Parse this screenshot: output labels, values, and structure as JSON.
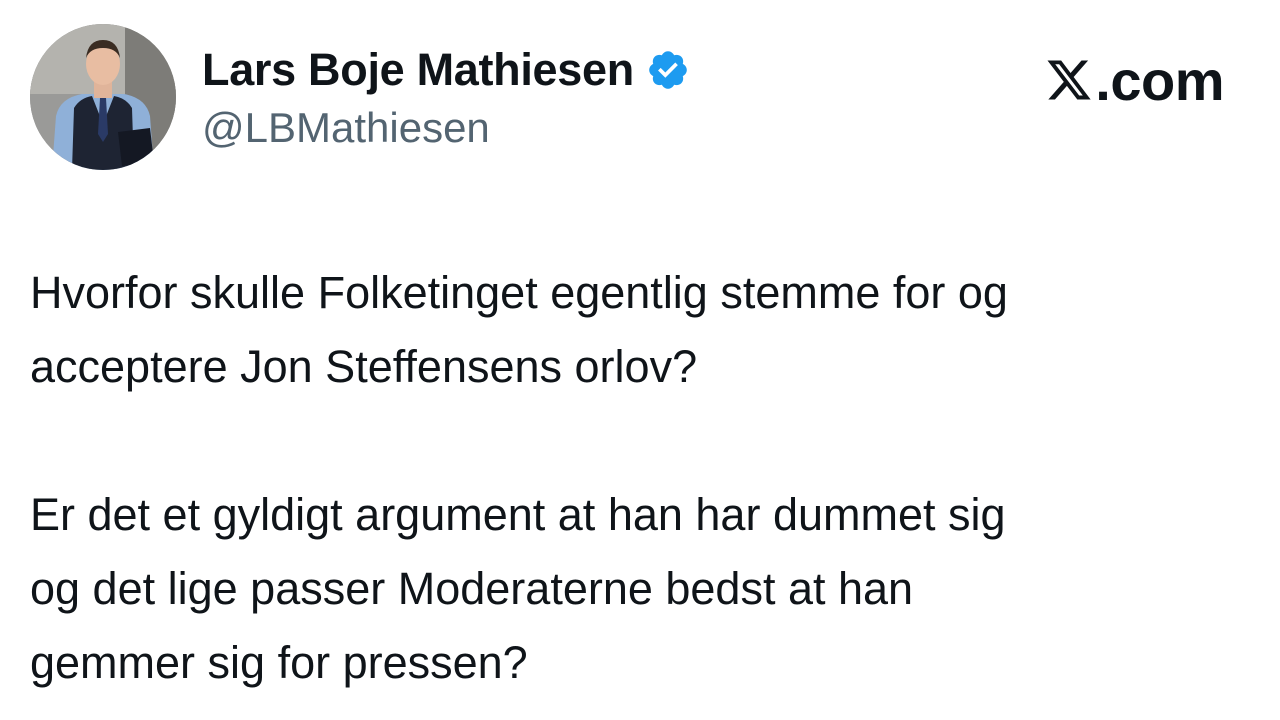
{
  "tweet": {
    "author": {
      "display_name": "Lars Boje Mathiesen",
      "handle": "@LBMathiesen",
      "verified": true,
      "avatar": "profile-photo"
    },
    "brand": {
      "icon": "x-logo-icon",
      "label": ".com"
    },
    "paragraphs": [
      "Hvorfor skulle Folketinget egentlig stemme for og\nacceptere Jon Steffensens orlov?",
      "Er det et gyldigt argument at han har dummet sig\nog det lige passer Moderaterne bedst at han\ngemmer sig for pressen?"
    ]
  },
  "colors": {
    "text": "#0f1419",
    "secondary_text": "#536471",
    "verified_badge": "#1d9bf0",
    "background": "#ffffff"
  }
}
